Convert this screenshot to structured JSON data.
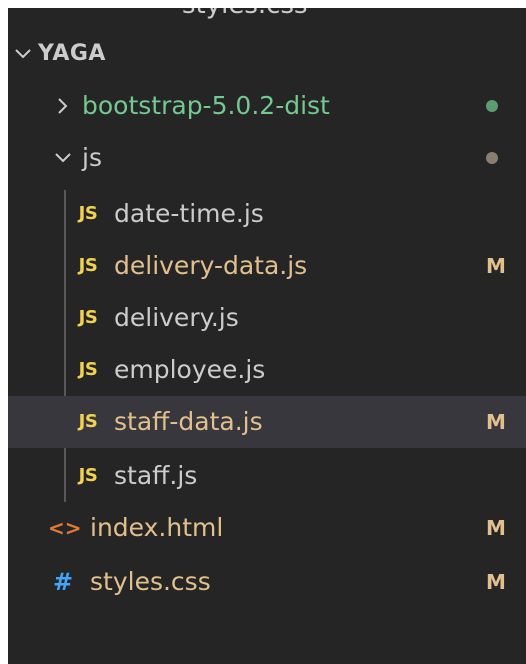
{
  "colors": {
    "background": "#252526",
    "selected_row": "#37373d",
    "text": "#cccccc",
    "modified": "#e2c08d",
    "untracked_green": "#73c991",
    "dot_green": "#5a9e6f",
    "dot_gray": "#8a7e6e",
    "js_icon": "#f1d251",
    "html_icon": "#e37933",
    "css_icon": "#42a5f5"
  },
  "top_cut_text": "styles.css",
  "tree": {
    "root": {
      "label": "YAGA",
      "icon": "chevron-down-icon"
    },
    "bootstrap_folder": {
      "label": "bootstrap-5.0.2-dist",
      "icon": "chevron-right-icon",
      "status": "dot"
    },
    "js_folder": {
      "label": "js",
      "icon": "chevron-down-icon",
      "status": "dot"
    },
    "js_files": [
      {
        "icon_text": "JS",
        "label": "date-time.js",
        "badge": ""
      },
      {
        "icon_text": "JS",
        "label": "delivery-data.js",
        "badge": "M"
      },
      {
        "icon_text": "JS",
        "label": "delivery.js",
        "badge": ""
      },
      {
        "icon_text": "JS",
        "label": "employee.js",
        "badge": ""
      },
      {
        "icon_text": "JS",
        "label": "staff-data.js",
        "badge": "M"
      },
      {
        "icon_text": "JS",
        "label": "staff.js",
        "badge": ""
      }
    ],
    "index_file": {
      "icon_text": "<>",
      "label": "index.html",
      "badge": "M"
    },
    "styles_file": {
      "icon_text": "#",
      "label": "styles.css",
      "badge": "M"
    }
  }
}
